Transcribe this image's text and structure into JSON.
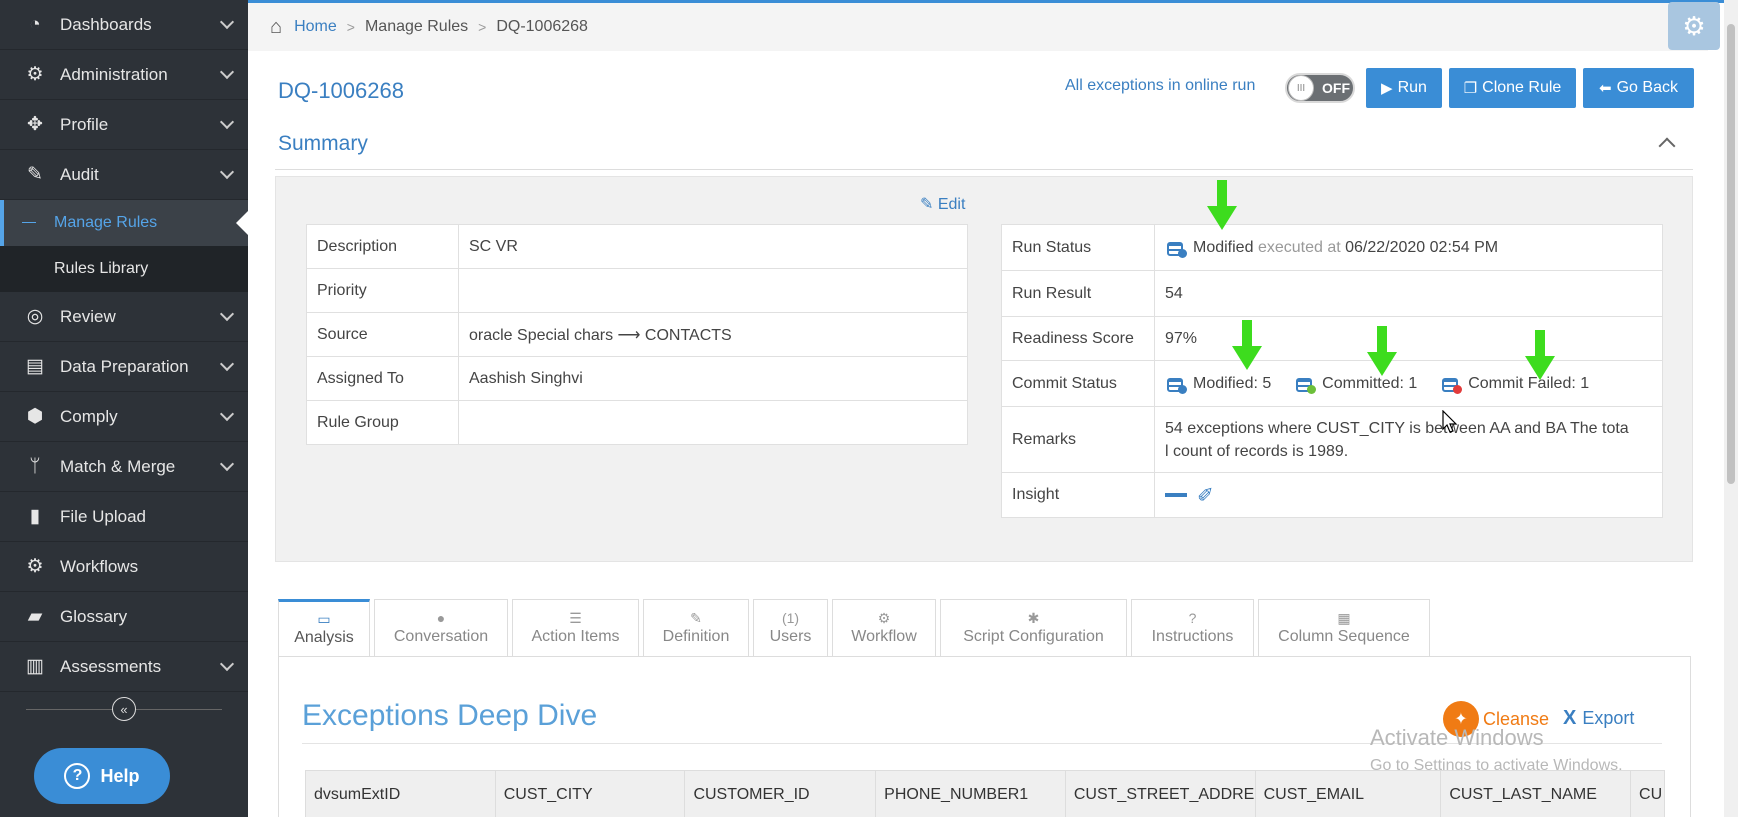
{
  "sidebar": {
    "items": [
      {
        "label": "Dashboards",
        "icon": "dashboard-icon"
      },
      {
        "label": "Administration",
        "icon": "cogs-icon"
      },
      {
        "label": "Profile",
        "icon": "crosshair-icon"
      },
      {
        "label": "Audit",
        "icon": "edit-icon"
      },
      {
        "label": "Review",
        "icon": "compass-icon"
      },
      {
        "label": "Data Preparation",
        "icon": "data-prep-icon"
      },
      {
        "label": "Comply",
        "icon": "tags-icon"
      },
      {
        "label": "Match & Merge",
        "icon": "branch-icon"
      },
      {
        "label": "File Upload",
        "icon": "file-icon"
      },
      {
        "label": "Workflows",
        "icon": "workflow-icon"
      },
      {
        "label": "Glossary",
        "icon": "glossary-icon"
      },
      {
        "label": "Assessments",
        "icon": "assessment-icon"
      }
    ],
    "audit_sub": [
      "Manage Rules",
      "Rules Library"
    ],
    "collapse_glyph": "«",
    "help_label": "Help",
    "help_glyph": "?"
  },
  "breadcrumb": {
    "home": "Home",
    "manage_rules": "Manage Rules",
    "current": "DQ-1006268",
    "separator": ">"
  },
  "header": {
    "rule_id": "DQ-1006268",
    "online_label": "All exceptions in online run",
    "toggle_state": "OFF",
    "toggle_knob": "III",
    "run": "Run",
    "clone": "Clone Rule",
    "back": "Go Back"
  },
  "summary": {
    "title": "Summary",
    "edit": "Edit",
    "left": [
      {
        "label": "Description",
        "value": "SC VR"
      },
      {
        "label": "Priority",
        "value": ""
      },
      {
        "label": "Source",
        "value": "oracle Special chars ⟶ CONTACTS"
      },
      {
        "label": "Assigned To",
        "value": "Aashish Singhvi"
      },
      {
        "label": "Rule Group",
        "value": ""
      }
    ],
    "right": {
      "run_status_label": "Run Status",
      "run_status_value": "Modified",
      "executed_at_label": "executed at",
      "executed_at_value": "06/22/2020 02:54 PM",
      "run_result_label": "Run Result",
      "run_result_value": "54",
      "readiness_label": "Readiness Score",
      "readiness_value": "97%",
      "commit_label": "Commit Status",
      "commit_modified": "Modified: 5",
      "commit_committed": "Committed: 1",
      "commit_failed": "Commit Failed: 1",
      "remarks_label": "Remarks",
      "remarks_line1": "54 exceptions where CUST_CITY is between AA and BA The tota",
      "remarks_line2": "l count of records is 1989.",
      "insight_label": "Insight"
    }
  },
  "tabs": [
    {
      "label": "Analysis",
      "icon": "▭"
    },
    {
      "label": "Conversation",
      "icon": "●"
    },
    {
      "label": "Action Items",
      "icon": "☰"
    },
    {
      "label": "Definition",
      "icon": "✎"
    },
    {
      "label": "Users",
      "icon": "(1)"
    },
    {
      "label": "Workflow",
      "icon": "⚙"
    },
    {
      "label": "Script Configuration",
      "icon": "✱"
    },
    {
      "label": "Instructions",
      "icon": "?"
    },
    {
      "label": "Column Sequence",
      "icon": "▦"
    }
  ],
  "deep_dive": {
    "title": "Exceptions Deep Dive",
    "cleanse": "Cleanse",
    "export": "Export",
    "columns": [
      "dvsumExtID",
      "CUST_CITY",
      "CUSTOMER_ID",
      "PHONE_NUMBER1",
      "CUST_STREET_ADDRESS",
      "CUST_EMAIL",
      "CUST_LAST_NAME",
      "CU"
    ]
  },
  "watermark": {
    "line1": "Activate Windows",
    "line2": "Go to Settings to activate Windows."
  },
  "colors": {
    "accent": "#3a8dd6",
    "sidebar": "#2d3238",
    "arrow": "#3ddc1e",
    "cleanse": "#f07b14"
  }
}
